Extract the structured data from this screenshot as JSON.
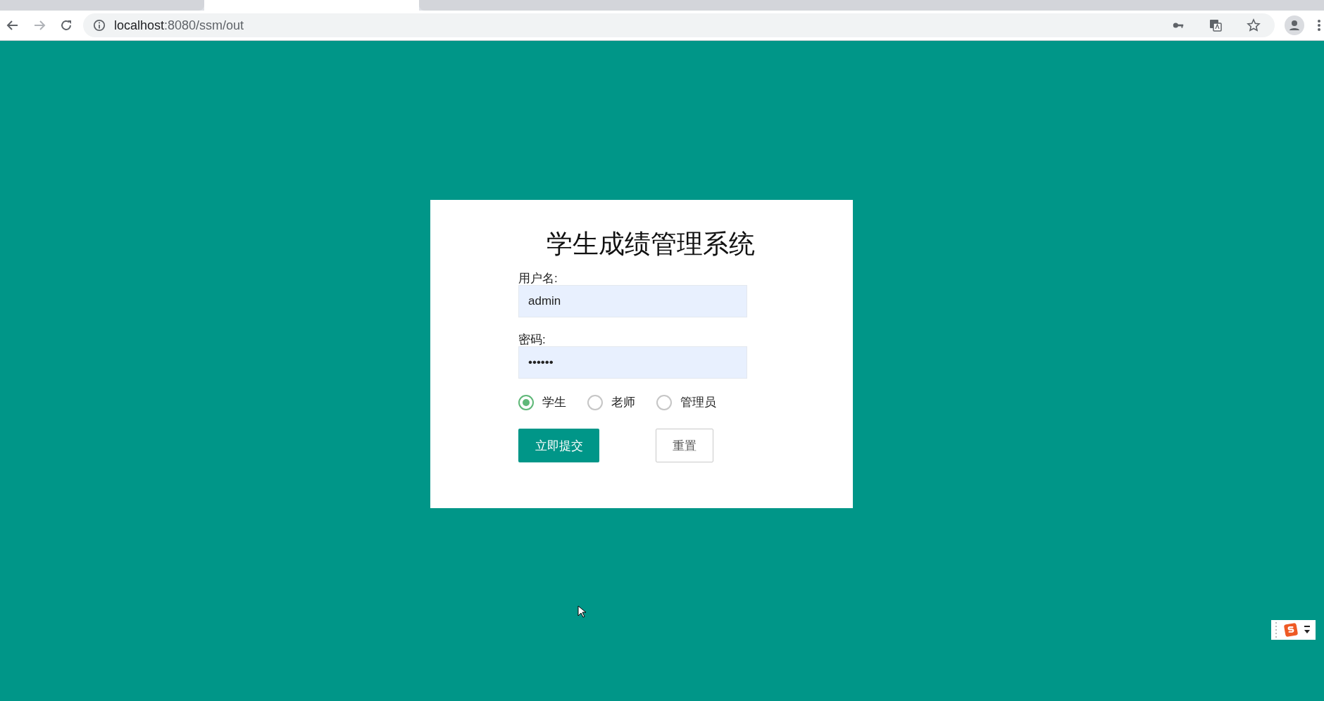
{
  "browser": {
    "tabs": [
      {
        "selected": false
      },
      {
        "selected": true
      },
      {
        "selected": false
      }
    ],
    "url_host": "localhost",
    "url_path": ":8080/ssm/out"
  },
  "login": {
    "title": "学生成绩管理系统",
    "fields": [
      {
        "label": "用户名:",
        "value": "admin"
      },
      {
        "label": "密码:",
        "value": "••••••"
      }
    ],
    "roles": [
      {
        "label": "学生",
        "selected": true
      },
      {
        "label": "老师",
        "selected": false
      },
      {
        "label": "管理员",
        "selected": false
      }
    ],
    "buttons": [
      {
        "label": "立即提交",
        "kind": "primary"
      },
      {
        "label": "重置",
        "kind": "secondary"
      }
    ]
  }
}
